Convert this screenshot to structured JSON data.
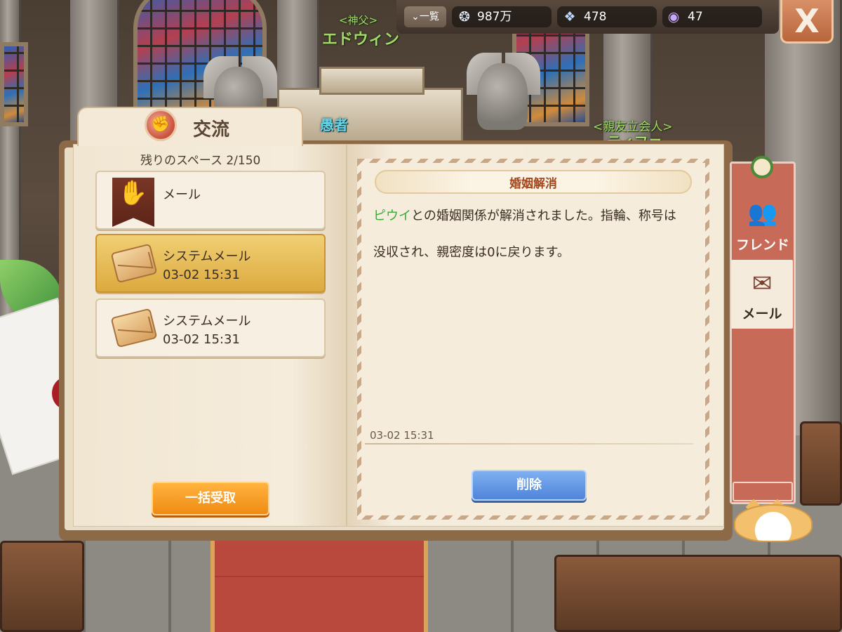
{
  "scene": {
    "npc_father_title": "<神父>",
    "npc_father_name": "エドウィン",
    "npc_fool_name": "愚者",
    "npc_club_title": "<親友立会人>",
    "npc_club_name": "ティファ"
  },
  "topbar": {
    "list_label": "一覧",
    "shells": "987万",
    "gems": "478",
    "pearls": "47",
    "close_label": "X"
  },
  "panel": {
    "title": "交流",
    "space_label": "残りのスペース 2/150",
    "bulk_receive": "一括受取",
    "mails": [
      {
        "title": "メール",
        "date": ""
      },
      {
        "title": "システムメール",
        "date": "03-02 15:31"
      },
      {
        "title": "システムメール",
        "date": "03-02 15:31"
      }
    ]
  },
  "message": {
    "title": "婚姻解消",
    "name": "ピウイ",
    "body_1": "との婚姻関係が解消されました。指輪、称号は",
    "body_2": "没収され、親密度は0に戻ります。",
    "date": "03-02 15:31",
    "delete_label": "削除"
  },
  "tabs": {
    "friend": "フレンド",
    "mail": "メール"
  },
  "colors": {
    "accent_orange": "#f08b14",
    "accent_blue": "#4f84d8",
    "name_green": "#3aa935",
    "tab_red": "#c76a58"
  }
}
